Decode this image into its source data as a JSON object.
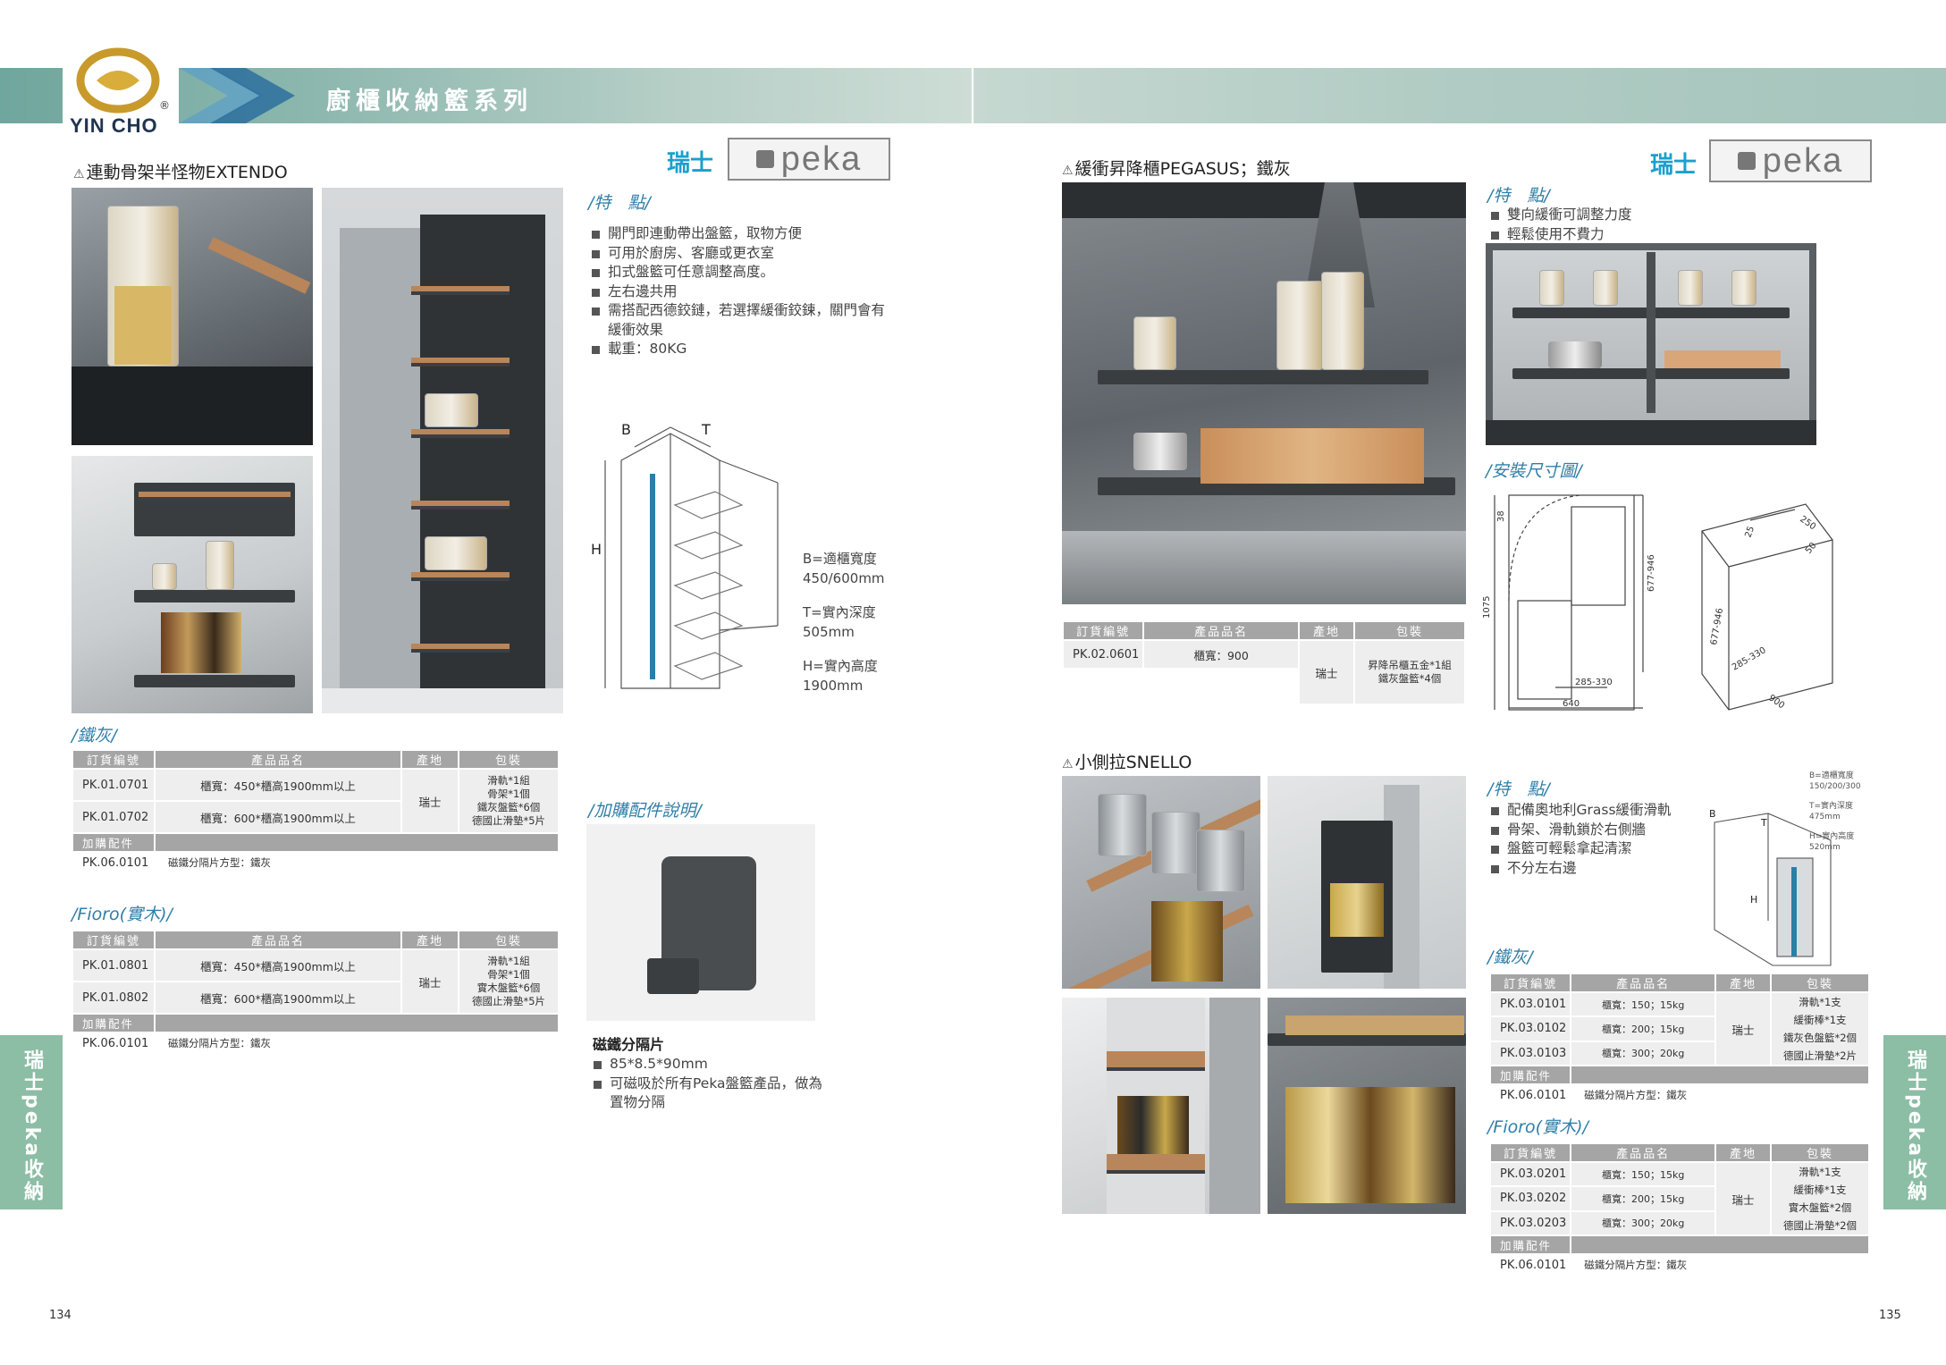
{
  "brand": {
    "logo_text": "YIN CHO",
    "registered_mark": "®"
  },
  "header": {
    "title": "廚櫃收納籃系列"
  },
  "side_tabs": {
    "left": "瑞士peka收納籃",
    "right": "瑞士peka收納籃"
  },
  "page_numbers": {
    "left": "134",
    "right": "135"
  },
  "extendo": {
    "title": "連動骨架半怪物EXTENDO",
    "origin": "瑞士",
    "brand": "peka",
    "features_heading": "/特　點/",
    "features": [
      "開門即連動帶出盤籃，取物方便",
      "可用於廚房、客廳或更衣室",
      "扣式盤籃可任意調整高度。",
      "左右邊共用",
      "需搭配西德鉸鏈，若選擇緩衝鉸鍊，關門會有緩衝效果",
      "載重：80KG"
    ],
    "diagram_labels": {
      "b": "B",
      "t": "T",
      "h": "H"
    },
    "dims": [
      "B=適櫃寬度",
      "450/600mm",
      "T=實內深度",
      "505mm",
      "H=實內高度",
      "1900mm"
    ],
    "iron_heading": "/鐵灰/",
    "fioro_heading": "/Fioro(實木)/",
    "table_headers": [
      "訂貨編號",
      "產品品名",
      "產地",
      "包裝"
    ],
    "iron_rows": [
      {
        "code": "PK.01.0701",
        "name": "櫃寬：450*櫃高1900mm以上"
      },
      {
        "code": "PK.01.0702",
        "name": "櫃寬：600*櫃高1900mm以上"
      }
    ],
    "iron_origin": "瑞士",
    "iron_pack": [
      "滑軌*1組",
      "骨架*1個",
      "鐵灰盤籃*6個",
      "德國止滑墊*5片"
    ],
    "accessory_label": "加購配件",
    "accessory": {
      "code": "PK.06.0101",
      "name": "磁鐵分隔片方型：鐵灰"
    },
    "fioro_rows": [
      {
        "code": "PK.01.0801",
        "name": "櫃寬：450*櫃高1900mm以上"
      },
      {
        "code": "PK.01.0802",
        "name": "櫃寬：600*櫃高1900mm以上"
      }
    ],
    "fioro_origin": "瑞士",
    "fioro_pack": [
      "滑軌*1組",
      "骨架*1個",
      "實木盤籃*6個",
      "德國止滑墊*5片"
    ],
    "fioro_accessory": {
      "code": "PK.06.0101",
      "name": "磁鐵分隔片方型：鐵灰"
    },
    "addon_heading": "/加購配件說明/",
    "addon_name": "磁鐵分隔片",
    "addon_features": [
      "85*8.5*90mm",
      "可磁吸於所有Peka盤籃產品，做為置物分隔"
    ]
  },
  "pegasus": {
    "title": "緩衝昇降櫃PEGASUS；鐵灰",
    "origin": "瑞士",
    "brand": "peka",
    "features_heading": "/特　點/",
    "features": [
      "雙向緩衝可調整力度",
      "輕鬆使用不費力"
    ],
    "install_heading": "/安裝尺寸圖/",
    "install_dims": [
      "38",
      "1075",
      "677-946",
      "285-330",
      "640",
      "250",
      "25",
      "50",
      "677-946",
      "285-330",
      "900"
    ],
    "table_headers": [
      "訂貨編號",
      "產品品名",
      "產地",
      "包裝"
    ],
    "row": {
      "code": "PK.02.0601",
      "name": "櫃寬：900",
      "origin": "瑞士",
      "pack": [
        "昇降吊櫃五金*1組",
        "鐵灰盤籃*4個"
      ]
    }
  },
  "snello": {
    "title": "小側拉SNELLO",
    "features_heading": "/特　點/",
    "features": [
      "配備奧地利Grass緩衝滑軌",
      "骨架、滑軌鎖於右側牆",
      "盤籃可輕鬆拿起清潔",
      "不分左右邊"
    ],
    "diagram_labels": {
      "b": "B",
      "t": "T",
      "h": "H"
    },
    "dims": [
      "B=適櫃寬度",
      "150/200/300",
      "T=實內深度",
      "475mm",
      "H=實內高度",
      "520mm"
    ],
    "iron_heading": "/鐵灰/",
    "fioro_heading": "/Fioro(實木)/",
    "table_headers": [
      "訂貨編號",
      "產品品名",
      "產地",
      "包裝"
    ],
    "iron_rows": [
      {
        "code": "PK.03.0101",
        "name": "櫃寬：150；15kg"
      },
      {
        "code": "PK.03.0102",
        "name": "櫃寬：200；15kg"
      },
      {
        "code": "PK.03.0103",
        "name": "櫃寬：300；20kg"
      }
    ],
    "iron_origin": "瑞士",
    "iron_pack": [
      "滑軌*1支",
      "緩衝棒*1支",
      "鐵灰色盤籃*2個",
      "德國止滑墊*2片"
    ],
    "accessory_label": "加購配件",
    "accessory": {
      "code": "PK.06.0101",
      "name": "磁鐵分隔片方型：鐵灰"
    },
    "fioro_rows": [
      {
        "code": "PK.03.0201",
        "name": "櫃寬：150；15kg"
      },
      {
        "code": "PK.03.0202",
        "name": "櫃寬：200；15kg"
      },
      {
        "code": "PK.03.0203",
        "name": "櫃寬：300；20kg"
      }
    ],
    "fioro_origin": "瑞士",
    "fioro_pack": [
      "滑軌*1支",
      "緩衝棒*1支",
      "實木盤籃*2個",
      "德國止滑墊*2個"
    ],
    "fioro_accessory": {
      "code": "PK.06.0101",
      "name": "磁鐵分隔片方型：鐵灰"
    }
  },
  "colors": {
    "header_teal": "#7fb0a6",
    "accent_blue": "#1aa0cc",
    "table_gray": "#a5a5a5",
    "side_tab_green": "#8cbda5",
    "wood": "#b8865a"
  }
}
